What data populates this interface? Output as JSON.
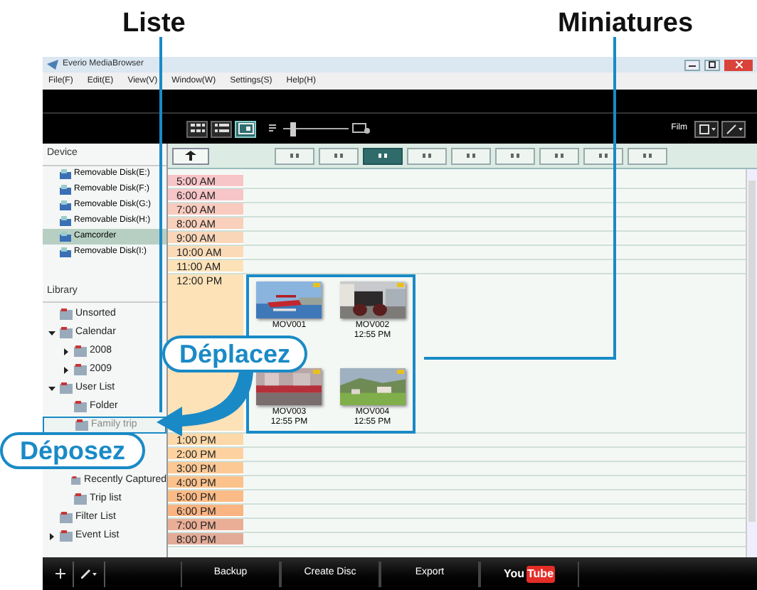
{
  "annotations": {
    "list_label": "Liste",
    "thumbnails_label": "Miniatures",
    "move_label": "Déplacez",
    "drop_label": "Déposez"
  },
  "window": {
    "title": "Everio MediaBrowser"
  },
  "menu": [
    "File(F)",
    "Edit(E)",
    "View(V)",
    "Window(W)",
    "Settings(S)",
    "Help(H)"
  ],
  "toolbar": {
    "views": [
      {
        "kind": "grid",
        "selected": false
      },
      {
        "kind": "list",
        "selected": false
      },
      {
        "kind": "calendar",
        "selected": true
      }
    ],
    "zoom": {
      "level": 0.12
    },
    "filter_label": "Film"
  },
  "sidebar": {
    "device_heading": "Device",
    "devices": [
      {
        "label": "Removable Disk(E:)",
        "selected": false
      },
      {
        "label": "Removable Disk(F:)",
        "selected": false
      },
      {
        "label": "Removable Disk(G:)",
        "selected": false
      },
      {
        "label": "Removable Disk(H:)",
        "selected": false
      },
      {
        "label": "Camcorder",
        "selected": true
      },
      {
        "label": "Removable Disk(I:)",
        "selected": false
      }
    ],
    "library_heading": "Library",
    "library": [
      {
        "label": "Unsorted",
        "selected": false
      },
      {
        "label": "Calendar",
        "selected": false,
        "expanded": true,
        "children": [
          {
            "label": "2008",
            "selected": false,
            "expanded": false
          },
          {
            "label": "2009",
            "selected": false,
            "expanded": false
          }
        ]
      },
      {
        "label": "User List",
        "selected": false,
        "expanded": true,
        "children": [
          {
            "label": "Folder",
            "selected": false
          },
          {
            "label": "Family trip",
            "selected": true
          },
          {
            "label": "Recently Captured",
            "selected": false
          },
          {
            "label": "Trip list",
            "selected": false
          }
        ]
      },
      {
        "label": "Filter List",
        "selected": false
      },
      {
        "label": "Event List",
        "selected": false,
        "expanded": false
      }
    ]
  },
  "scale_tabs": [
    {
      "selected": false
    },
    {
      "selected": false
    },
    {
      "selected": true
    },
    {
      "selected": false
    },
    {
      "selected": false
    },
    {
      "selected": false
    },
    {
      "selected": false
    },
    {
      "selected": false
    },
    {
      "selected": false
    }
  ],
  "timeline": [
    {
      "time": "5:00 AM",
      "color": "#f7c4c8"
    },
    {
      "time": "6:00 AM",
      "color": "#f7c4c8"
    },
    {
      "time": "7:00 AM",
      "color": "#f9cbbf"
    },
    {
      "time": "8:00 AM",
      "color": "#f9d0bc"
    },
    {
      "time": "9:00 AM",
      "color": "#fad6b9"
    },
    {
      "time": "10:00 AM",
      "color": "#fbdbb7"
    },
    {
      "time": "11:00 AM",
      "color": "#fde2b8"
    },
    {
      "time": "12:00 PM",
      "color": "#fde2b8",
      "thumbnails": [
        {
          "name": "MOV001",
          "kind": "seaplane"
        },
        {
          "name": "MOV002",
          "time": "12:55 PM",
          "kind": "carriage"
        },
        {
          "name": "MOV003",
          "time": "12:55 PM",
          "kind": "street"
        },
        {
          "name": "MOV004",
          "time": "12:55 PM",
          "kind": "village"
        }
      ]
    },
    {
      "time": "1:00 PM",
      "color": "#fdd8a8"
    },
    {
      "time": "2:00 PM",
      "color": "#fdd2a0"
    },
    {
      "time": "3:00 PM",
      "color": "#fcc995"
    },
    {
      "time": "4:00 PM",
      "color": "#fcc28c"
    },
    {
      "time": "5:00 PM",
      "color": "#fbbb86"
    },
    {
      "time": "6:00 PM",
      "color": "#f9b482"
    },
    {
      "time": "7:00 PM",
      "color": "#eaae96"
    },
    {
      "time": "8:00 PM",
      "color": "#e2ab98"
    }
  ],
  "bottom_bar": {
    "buttons": [
      "Backup",
      "Create Disc",
      "Export"
    ],
    "upload_logo": [
      "You",
      "Tube"
    ]
  }
}
